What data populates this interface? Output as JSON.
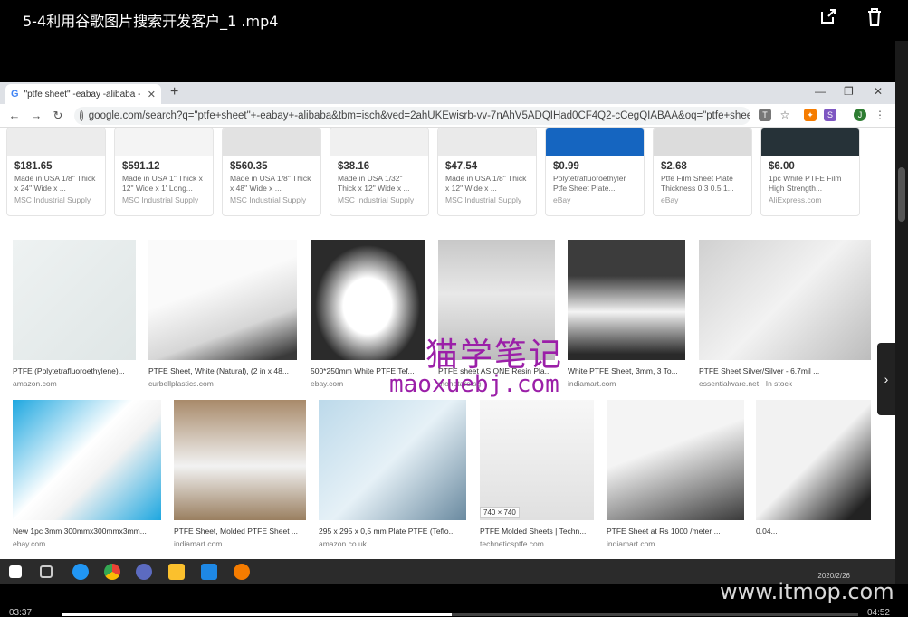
{
  "player": {
    "title": "5-4利用谷歌图片搜索开发客户_1  .mp4",
    "time_current": "03:37",
    "time_total": "04:52",
    "progress": 0.49
  },
  "browser": {
    "tab_title": "\"ptfe sheet\" -eabay -alibaba -",
    "url": "google.com/search?q=\"ptfe+sheet\"+-eabay+-alibaba&tbm=isch&ved=2ahUKEwisrb-vv-7nAhV5ADQIHad0CF4Q2-cCegQIABAA&oq=\"ptfe+sheet\"..."
  },
  "shopping": [
    {
      "price": "$181.65",
      "desc": "Made in USA 1/8\" Thick x 24\" Wide x ...",
      "seller": "MSC Industrial Supply"
    },
    {
      "price": "$591.12",
      "desc": "Made in USA 1\" Thick x 12\" Wide x 1' Long...",
      "seller": "MSC Industrial Supply"
    },
    {
      "price": "$560.35",
      "desc": "Made in USA 1/8\" Thick x 48\" Wide x ...",
      "seller": "MSC Industrial Supply"
    },
    {
      "price": "$38.16",
      "desc": "Made in USA 1/32\" Thick x 12\" Wide x ...",
      "seller": "MSC Industrial Supply"
    },
    {
      "price": "$47.54",
      "desc": "Made in USA 1/8\" Thick x 12\" Wide x ...",
      "seller": "MSC Industrial Supply"
    },
    {
      "price": "$0.99",
      "desc": "Polytetrafluoroethyler Ptfe Sheet Plate...",
      "seller": "eBay"
    },
    {
      "price": "$2.68",
      "desc": "Ptfe Film Sheet Plate Thickness 0.3 0.5 1...",
      "seller": "eBay"
    },
    {
      "price": "$6.00",
      "desc": "1pc White PTFE Film High Strength...",
      "seller": "AliExpress.com"
    }
  ],
  "row1": [
    {
      "cap": "PTFE (Polytetrafluoroethylene)...",
      "src": "amazon.com"
    },
    {
      "cap": "PTFE Sheet, White (Natural), (2 in x 48...",
      "src": "curbellplastics.com"
    },
    {
      "cap": "500*250mm White PTFE Tef...",
      "src": "ebay.com"
    },
    {
      "cap": "PTFE sheet AS ONE Resin Pla...",
      "src": "monotaro.sg"
    },
    {
      "cap": "White PTFE Sheet, 3mm, 3 To...",
      "src": "indiamart.com"
    },
    {
      "cap": "PTFE Sheet Silver/Silver - 6.7mil ...",
      "src": "essentialware.net · In stock"
    }
  ],
  "row2": [
    {
      "cap": "New 1pc 3mm 300mmx300mmx3mm...",
      "src": "ebay.com"
    },
    {
      "cap": "PTFE Sheet, Molded PTFE Sheet ...",
      "src": "indiamart.com"
    },
    {
      "cap": "295 x 295 x 0,5 mm Plate PTFE (Teflo...",
      "src": "amazon.co.uk"
    },
    {
      "cap": "PTFE Molded Sheets | Techn...",
      "src": "techneticsptfe.com"
    },
    {
      "cap": "PTFE Sheet at Rs 1000 /meter ...",
      "src": "indiamart.com"
    },
    {
      "cap": "0.04...",
      "src": ""
    }
  ],
  "overlay": {
    "watermark_cn": "猫学笔记",
    "watermark_url": "maoxuebj.com",
    "image_dims": "740 × 740",
    "site": "www.itmop.com",
    "clock": "2020/2/26"
  },
  "colors": {
    "accent": "#9b1fa8",
    "ebay_blue": "#1e88e5"
  }
}
